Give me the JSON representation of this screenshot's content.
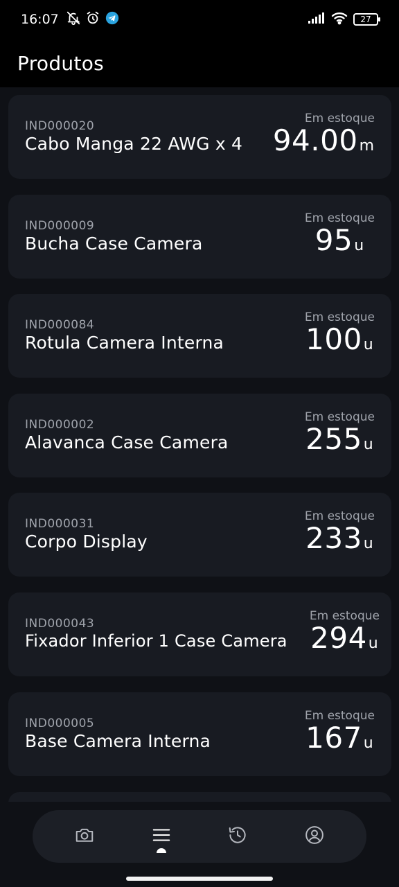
{
  "status": {
    "time": "16:07",
    "battery": "27"
  },
  "appbar": {
    "title": "Produtos"
  },
  "products": [
    {
      "code": "IND000020",
      "name": "Cabo Manga 22 AWG x 4",
      "stock_label": "Em estoque",
      "quantity": "94.00",
      "unit": "m"
    },
    {
      "code": "IND000009",
      "name": "Bucha Case Camera",
      "stock_label": "Em estoque",
      "quantity": "95",
      "unit": "u"
    },
    {
      "code": "IND000084",
      "name": "Rotula Camera Interna",
      "stock_label": "Em estoque",
      "quantity": "100",
      "unit": "u"
    },
    {
      "code": "IND000002",
      "name": "Alavanca Case Camera",
      "stock_label": "Em estoque",
      "quantity": "255",
      "unit": "u"
    },
    {
      "code": "IND000031",
      "name": "Corpo Display",
      "stock_label": "Em estoque",
      "quantity": "233",
      "unit": "u"
    },
    {
      "code": "IND000043",
      "name": "Fixador Inferior 1 Case Camera",
      "stock_label": "Em estoque",
      "quantity": "294",
      "unit": "u"
    },
    {
      "code": "IND000005",
      "name": "Base Camera Interna",
      "stock_label": "Em estoque",
      "quantity": "167",
      "unit": "u"
    }
  ],
  "nav": {
    "items": [
      {
        "icon": "camera-icon"
      },
      {
        "icon": "list-icon",
        "active": true
      },
      {
        "icon": "history-icon"
      },
      {
        "icon": "account-icon"
      }
    ]
  }
}
